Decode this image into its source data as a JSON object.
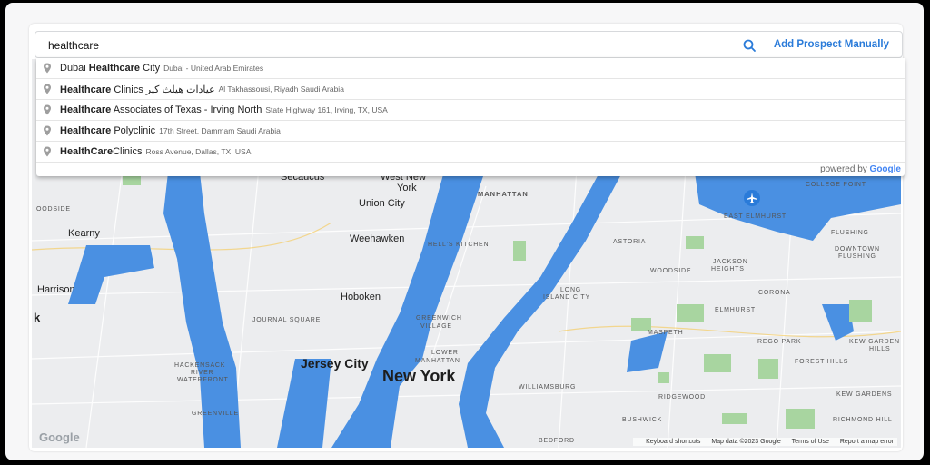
{
  "search": {
    "value": "healthcare",
    "add_label": "Add Prospect Manually"
  },
  "suggestions": [
    {
      "pre": "Dubai ",
      "bold": "Healthcare",
      "post": " City",
      "secondary": "Dubai - United Arab Emirates"
    },
    {
      "pre": "",
      "bold": "Healthcare",
      "post": " Clinics عيادات هيلث كير",
      "secondary": "Al Takhassousi, Riyadh Saudi Arabia"
    },
    {
      "pre": "",
      "bold": "Healthcare",
      "post": " Associates of Texas - Irving North",
      "secondary": "State Highway 161, Irving, TX, USA"
    },
    {
      "pre": "",
      "bold": "Healthcare",
      "post": " Polyclinic",
      "secondary": "17th Street, Dammam Saudi Arabia"
    },
    {
      "pre": "",
      "bold": "HealthCare",
      "post": "Clinics",
      "secondary": "Ross Avenue, Dallas, TX, USA"
    }
  ],
  "powered_by": {
    "text": "powered by ",
    "brand": "Google"
  },
  "map": {
    "labels": {
      "secaucus": "Secaucus",
      "west_new_york": "West New",
      "york": "York",
      "union_city": "Union City",
      "manhattan": "MANHATTAN",
      "kearny": "Kearny",
      "weehawken": "Weehawken",
      "hells_kitchen": "HELL'S KITCHEN",
      "harrison": "Harrison",
      "hoboken": "Hoboken",
      "journal_square": "JOURNAL SQUARE",
      "greenwich_village": "GREENWICH",
      "village": "VILLAGE",
      "jersey_city": "Jersey City",
      "new_york": "New York",
      "lower_manhattan": "LOWER",
      "manhattan2": "MANHATTAN",
      "hackensack": "HACKENSACK",
      "river": "RIVER",
      "waterfront": "WATERFRONT",
      "greenville": "GREENVILLE",
      "williamsburg": "WILLIAMSBURG",
      "bushwick": "BUSHWICK",
      "ridgewood": "RIDGEWOOD",
      "maspeth": "MASPETH",
      "long_island_city": "LONG",
      "island_city": "ISLAND CITY",
      "astoria": "ASTORIA",
      "woodside": "WOODSIDE",
      "jackson_heights": "JACKSON",
      "heights": "HEIGHTS",
      "elmhurst": "ELMHURST",
      "east_elmhurst": "EAST ELMHURST",
      "corona": "CORONA",
      "rego_park": "REGO PARK",
      "forest_hills": "FOREST HILLS",
      "kew_gardens_hills": "KEW GARDEN",
      "hills": "HILLS",
      "kew_gardens": "KEW GARDENS",
      "richmond_hill": "RICHMOND HILL",
      "flushing": "FLUSHING",
      "downtown_flushing": "DOWNTOWN",
      "flushing2": "FLUSHING",
      "college_point": "COLLEGE POINT",
      "woodside_left": "OODSIDE",
      "k": "k",
      "bedford": "BEDFORD"
    },
    "footer": {
      "shortcuts": "Keyboard shortcuts",
      "data": "Map data ©2023 Google",
      "terms": "Terms of Use",
      "report": "Report a map error"
    },
    "logo": "Google",
    "water_color": "#4a90e2",
    "park_color": "#a8d5a0"
  }
}
